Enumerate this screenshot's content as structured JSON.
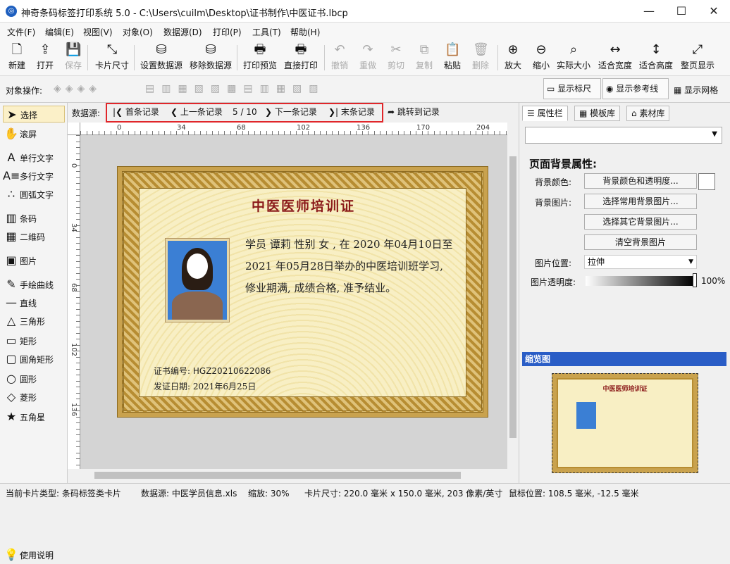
{
  "window": {
    "title": "神奇条码标签打印系统 5.0 - C:\\Users\\cuilm\\Desktop\\证书制作\\中医证书.lbcp",
    "minimize": "—",
    "maximize": "☐",
    "close": "✕"
  },
  "menu": [
    "文件(F)",
    "编辑(E)",
    "视图(V)",
    "对象(O)",
    "数据源(D)",
    "打印(P)",
    "工具(T)",
    "帮助(H)"
  ],
  "toolbar": [
    {
      "label": "新建",
      "icon": "new-file-icon",
      "glyph": "🗋",
      "enabled": true
    },
    {
      "label": "打开",
      "icon": "open-icon",
      "glyph": "⇪",
      "enabled": true
    },
    {
      "label": "保存",
      "icon": "save-icon",
      "glyph": "💾",
      "enabled": false
    },
    {
      "label": "卡片尺寸",
      "icon": "card-size-icon",
      "glyph": "⤡",
      "enabled": true
    },
    {
      "label": "设置数据源",
      "icon": "set-datasource-icon",
      "glyph": "⛁",
      "enabled": true
    },
    {
      "label": "移除数据源",
      "icon": "remove-datasource-icon",
      "glyph": "⛁",
      "enabled": true
    },
    {
      "label": "打印预览",
      "icon": "print-preview-icon",
      "glyph": "🖶",
      "enabled": true
    },
    {
      "label": "直接打印",
      "icon": "print-icon",
      "glyph": "🖶",
      "enabled": true
    },
    {
      "label": "撤销",
      "icon": "undo-icon",
      "glyph": "↶",
      "enabled": false
    },
    {
      "label": "重做",
      "icon": "redo-icon",
      "glyph": "↷",
      "enabled": false
    },
    {
      "label": "剪切",
      "icon": "cut-icon",
      "glyph": "✂",
      "enabled": false
    },
    {
      "label": "复制",
      "icon": "copy-icon",
      "glyph": "⧉",
      "enabled": false
    },
    {
      "label": "粘贴",
      "icon": "paste-icon",
      "glyph": "📋",
      "enabled": true
    },
    {
      "label": "删除",
      "icon": "delete-icon",
      "glyph": "🗑",
      "enabled": false
    },
    {
      "label": "放大",
      "icon": "zoom-in-icon",
      "glyph": "⊕",
      "enabled": true
    },
    {
      "label": "缩小",
      "icon": "zoom-out-icon",
      "glyph": "⊖",
      "enabled": true
    },
    {
      "label": "实际大小",
      "icon": "actual-size-icon",
      "glyph": "⌕",
      "enabled": true
    },
    {
      "label": "适合宽度",
      "icon": "fit-width-icon",
      "glyph": "↔",
      "enabled": true
    },
    {
      "label": "适合高度",
      "icon": "fit-height-icon",
      "glyph": "↕",
      "enabled": true
    },
    {
      "label": "整页显示",
      "icon": "fit-page-icon",
      "glyph": "⤢",
      "enabled": true
    }
  ],
  "object_ops_label": "对象操作:",
  "toggles": {
    "ruler": "显示标尺",
    "guides": "显示参考线",
    "grid": "显示网格"
  },
  "tools": [
    {
      "label": "选择",
      "icon": "select-icon",
      "glyph": "➤",
      "selected": true
    },
    {
      "label": "滚屏",
      "icon": "hand-icon",
      "glyph": "✋",
      "selected": false
    },
    {
      "label": "单行文字",
      "icon": "single-text-icon",
      "glyph": "A",
      "selected": false
    },
    {
      "label": "多行文字",
      "icon": "multi-text-icon",
      "glyph": "A≡",
      "selected": false
    },
    {
      "label": "圆弧文字",
      "icon": "arc-text-icon",
      "glyph": "∴",
      "selected": false
    },
    {
      "label": "条码",
      "icon": "barcode-icon",
      "glyph": "▥",
      "selected": false
    },
    {
      "label": "二维码",
      "icon": "qrcode-icon",
      "glyph": "▦",
      "selected": false
    },
    {
      "label": "图片",
      "icon": "image-icon",
      "glyph": "▣",
      "selected": false
    },
    {
      "label": "手绘曲线",
      "icon": "freehand-icon",
      "glyph": "✎",
      "selected": false
    },
    {
      "label": "直线",
      "icon": "line-icon",
      "glyph": "—",
      "selected": false
    },
    {
      "label": "三角形",
      "icon": "triangle-icon",
      "glyph": "△",
      "selected": false
    },
    {
      "label": "矩形",
      "icon": "rectangle-icon",
      "glyph": "▭",
      "selected": false
    },
    {
      "label": "圆角矩形",
      "icon": "rounded-rect-icon",
      "glyph": "▢",
      "selected": false
    },
    {
      "label": "圆形",
      "icon": "circle-icon",
      "glyph": "○",
      "selected": false
    },
    {
      "label": "菱形",
      "icon": "diamond-icon",
      "glyph": "◇",
      "selected": false
    },
    {
      "label": "五角星",
      "icon": "star-icon",
      "glyph": "★",
      "selected": false
    }
  ],
  "help_label": "使用说明",
  "records": {
    "label": "数据源:",
    "first": "首条记录",
    "prev": "上一条记录",
    "position": "5 / 10",
    "next": "下一条记录",
    "last": "末条记录",
    "jump": "跳转到记录"
  },
  "ruler_top": [
    "0",
    "34",
    "68",
    "102",
    "136",
    "170",
    "204"
  ],
  "ruler_left": [
    "0",
    "34",
    "68",
    "102",
    "136"
  ],
  "certificate": {
    "title": "中医医师培训证",
    "body": "学员 谭莉   性别 女 , 在 2020 年04月10日至   2021 年05月28日举办的中医培训班学习, 修业期满, 成绩合格, 准予结业。",
    "cert_no_label": "证书编号:",
    "cert_no": "HGZ20210622086",
    "issue_label": "发证日期:",
    "issue_date": "2021年6月25日"
  },
  "panel": {
    "tabs": [
      "属性栏",
      "模板库",
      "素材库"
    ],
    "section_title": "页面背景属性:",
    "bg_color_label": "背景颜色:",
    "bg_color_btn": "背景颜色和透明度...",
    "bg_image_label": "背景图片:",
    "btn_common": "选择常用背景图片...",
    "btn_other": "选择其它背景图片...",
    "btn_clear": "清空背景图片",
    "pos_label": "图片位置:",
    "pos_value": "拉伸",
    "opacity_label": "图片透明度:",
    "opacity_value": "100%",
    "preview_title": "缩览图"
  },
  "status": {
    "card_type": "当前卡片类型: 条码标签类卡片",
    "datasource": "数据源: 中医学员信息.xls",
    "zoom": "缩放: 30%",
    "card_size": "卡片尺寸: 220.0 毫米 x 150.0 毫米, 203 像素/英寸",
    "mouse": "鼠标位置: 108.5 毫米, -12.5 毫米"
  },
  "colors": {
    "accent": "#1e5fbf",
    "highlight": "#e0262a",
    "cert_title": "#8b1a1a"
  }
}
